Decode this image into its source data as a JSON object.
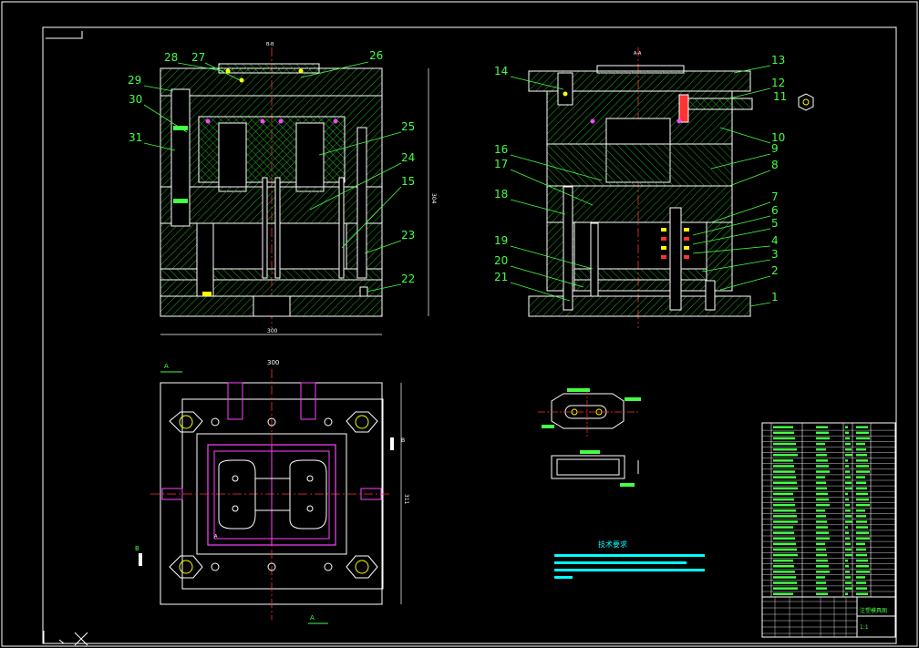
{
  "colors": {
    "background": "#000000",
    "frame": "#ffffff",
    "outline": "#ffffff",
    "hatch": "#22aa22",
    "leader": "#44ff44",
    "magenta": "#ff44ff",
    "yellow": "#ffff00",
    "red": "#ff3333",
    "cyan": "#00ffff"
  },
  "front_view": {
    "section_mark": "B-B",
    "width_dim": "300",
    "height_dim": "304",
    "part_numbers_left": [
      "29",
      "30",
      "31"
    ],
    "part_numbers_top": [
      "28",
      "27",
      "26"
    ],
    "part_numbers_right": [
      "25",
      "24",
      "15",
      "23",
      "22"
    ]
  },
  "side_view": {
    "section_mark": "A-A",
    "part_numbers_left": [
      "14",
      "16",
      "17",
      "18",
      "19",
      "20",
      "21"
    ],
    "part_numbers_right": [
      "13",
      "12",
      "11",
      "10",
      "9",
      "8",
      "7",
      "6",
      "5",
      "4",
      "3",
      "2",
      "1"
    ]
  },
  "plan_view": {
    "top_dim": "300",
    "left_section": "A",
    "right_section": "B",
    "bottom_section": "A",
    "left_label_mid": "B",
    "right_label_mid": "B",
    "center_label": "A",
    "side_dim": "311"
  },
  "part_drawing": {
    "view": "part"
  },
  "notes": {
    "title": "技术要求"
  },
  "title_block": {
    "drawing_name": "注塑模具图",
    "scale": "1:1"
  }
}
